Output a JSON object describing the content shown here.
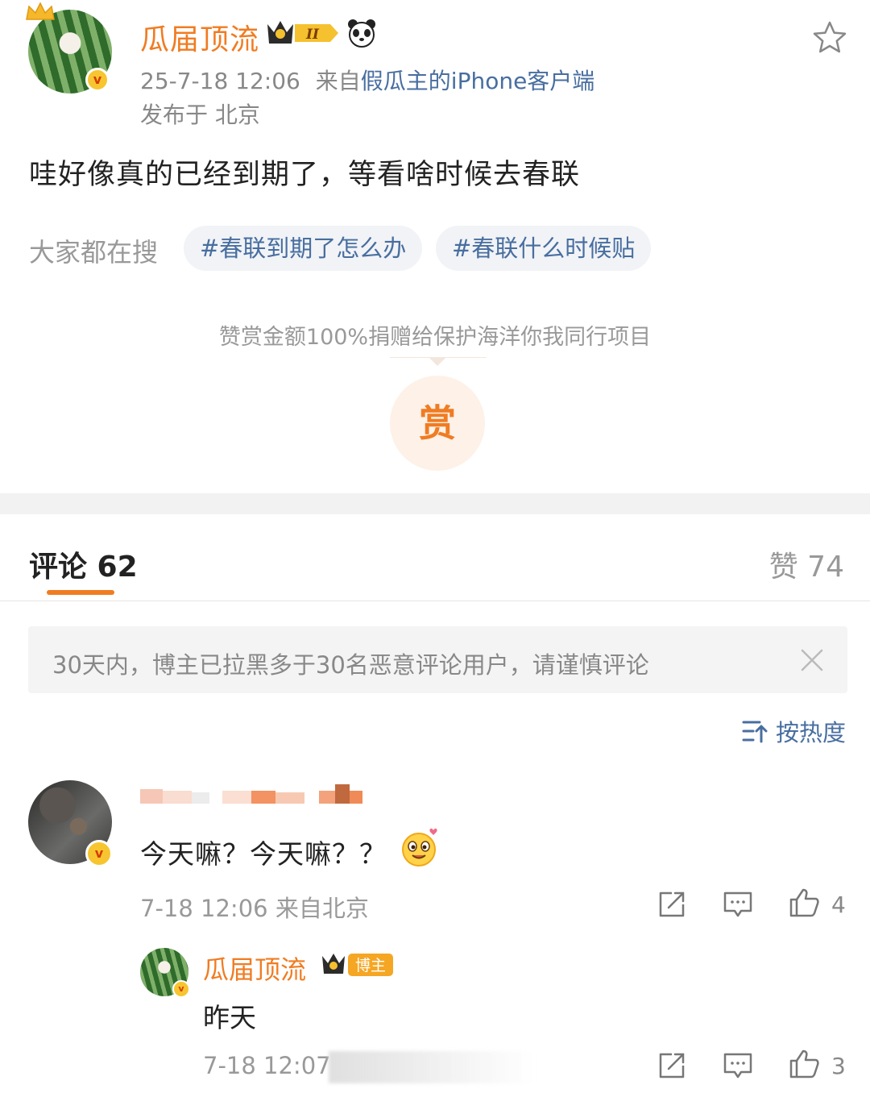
{
  "post": {
    "author": "瓜届顶流",
    "level": "II",
    "timestamp": "25-7-18 12:06",
    "source_prefix": "来自",
    "source": "假瓜主的iPhone客户端",
    "location": "发布于 北京",
    "text": "哇好像真的已经到期了，等看啥时候去春联",
    "search_label": "大家都在搜",
    "tags": [
      "#春联到期了怎么办",
      "#春联什么时候贴"
    ],
    "reward_text": "赞赏金额100%捐赠给保护海洋你我同行项目",
    "reward_button": "赏"
  },
  "tabs": {
    "comments": "评论 62",
    "likes": "赞 74"
  },
  "notice": {
    "text": "30天内，博主已拉黑多于30名恶意评论用户，请谨慎评论"
  },
  "sort": {
    "label": "按热度"
  },
  "comments": [
    {
      "text": "今天嘛？今天嘛？？",
      "time": "7-18 12:06 来自北京",
      "likes": "4",
      "replies": [
        {
          "author": "瓜届顶流",
          "badge": "博主",
          "text": "昨天",
          "time": "7-18 12:07",
          "likes": "3"
        }
      ]
    }
  ],
  "colors": {
    "accent": "#f07c22",
    "link": "#486ea0",
    "muted": "#999999"
  }
}
